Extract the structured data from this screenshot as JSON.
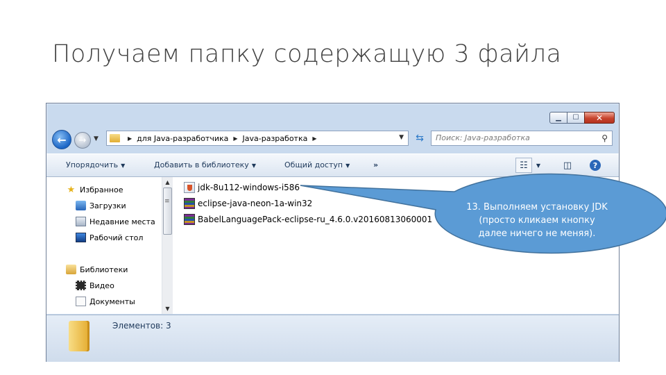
{
  "slide": {
    "title": "Получаем папку содержащую 3 файла"
  },
  "window": {
    "controls": {
      "minimize": "▁",
      "maximize": "☐",
      "close": "✕"
    },
    "address": {
      "segments": [
        "для Java-разработчика",
        "Java-разработка"
      ]
    },
    "search": {
      "placeholder": "Поиск: Java-разработка"
    },
    "toolbar": {
      "organize": "Упорядочить",
      "add_to_library": "Добавить в библиотеку",
      "share": "Общий доступ",
      "more": "»"
    },
    "nav": {
      "favorites": "Избранное",
      "downloads": "Загрузки",
      "recent": "Недавние места",
      "desktop": "Рабочий стол",
      "libraries": "Библиотеки",
      "video": "Видео",
      "documents": "Документы"
    },
    "files": [
      {
        "name": "jdk-8u112-windows-i586",
        "icon": "java-installer-icon"
      },
      {
        "name": "eclipse-java-neon-1a-win32",
        "icon": "rar-archive-icon"
      },
      {
        "name": "BabelLanguagePack-eclipse-ru_4.6.0.v20160813060001",
        "icon": "rar-archive-icon"
      }
    ],
    "status": {
      "count": "Элементов: 3"
    }
  },
  "callout": {
    "lines": [
      "13. Выполняем установку JDK",
      "(просто кликаем кнопку",
      "далее ничего не меняя)."
    ],
    "fill": "#5b9bd5",
    "stroke": "#41719c"
  }
}
